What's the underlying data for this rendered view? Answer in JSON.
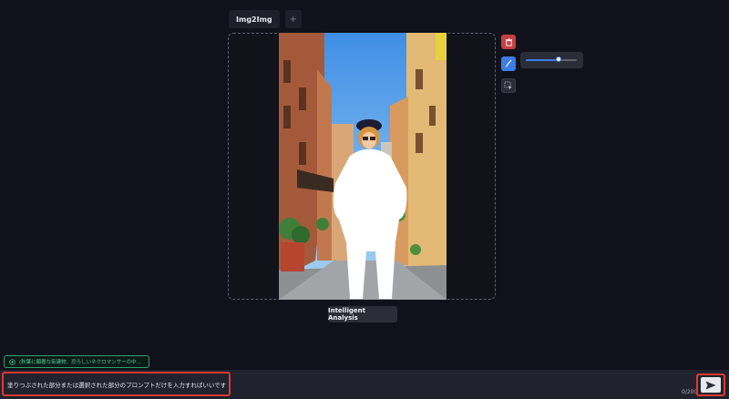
{
  "tabs": [
    {
      "label": "Img2Img"
    },
    {
      "label": "+"
    }
  ],
  "toolbar": {
    "brush_size_percent": 65
  },
  "analysis_button_label": "Intelligent Analysis",
  "suggestion_text": "(秋葉に顕著な街建物、恐ろしいネクロマンサーの中...",
  "prompt": {
    "value": "塗りつぶされた部分または選択された部分のプロンプトだけを入力すればいいです",
    "counter": "0/200"
  },
  "colors": {
    "accent": "#3d7de6",
    "danger": "#c44040",
    "highlight": "#e03a2e",
    "suggestion": "#2aa36e",
    "background": "#10111b"
  },
  "icons": {
    "delete": "trash-icon",
    "brush": "brush-icon",
    "select": "selection-icon",
    "send": "send-icon",
    "suggestion": "magic-icon"
  }
}
